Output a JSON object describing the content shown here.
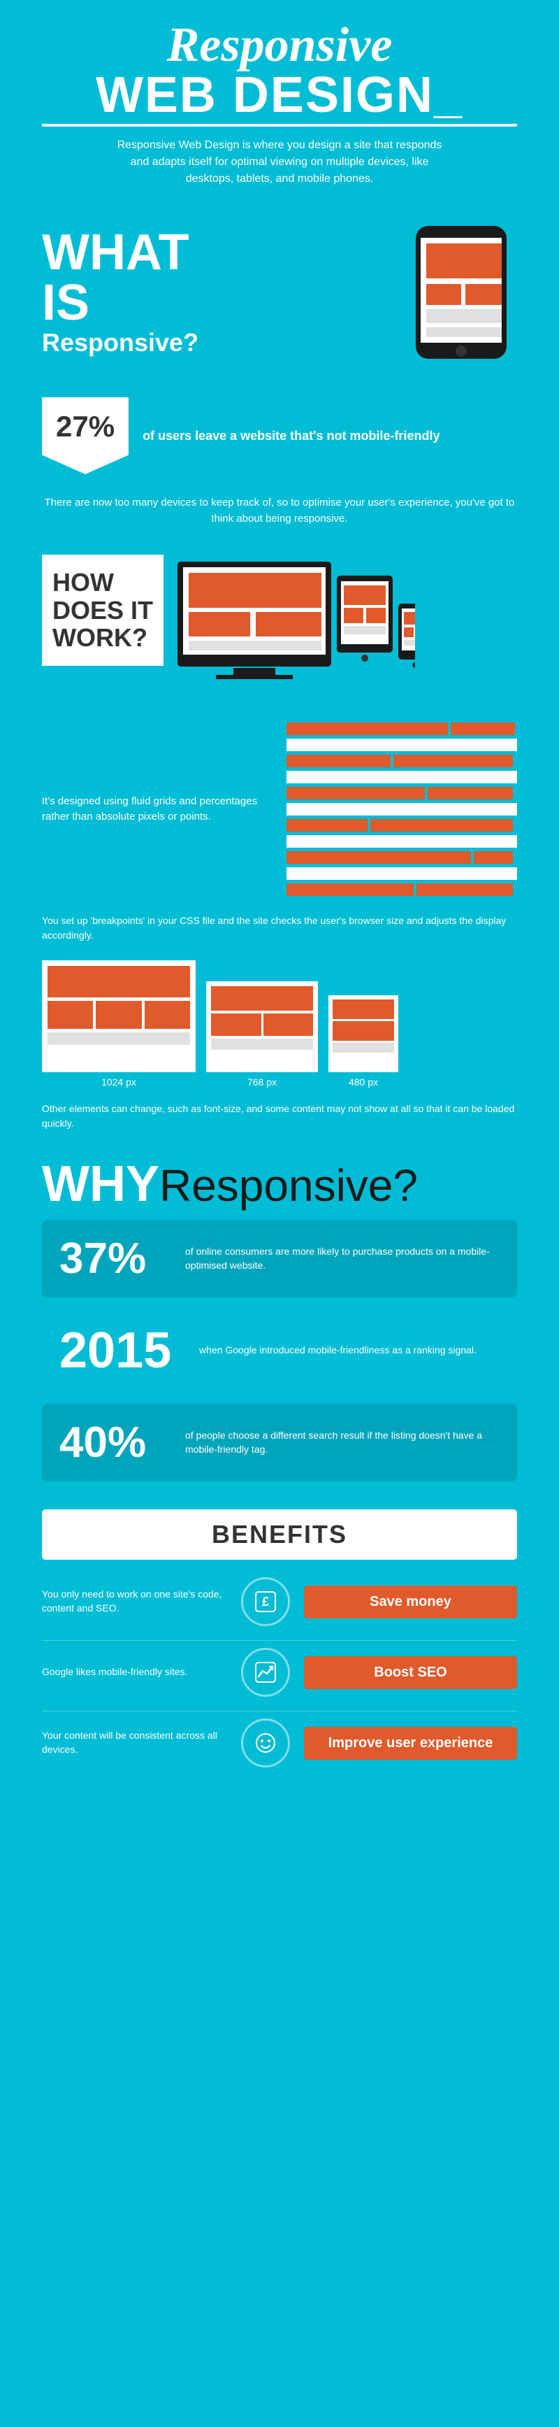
{
  "header": {
    "title_italic": "Responsive",
    "title_bold": "WEB DESIGN_",
    "description": "Responsive Web Design is where you design a site that responds and adapts itself for optimal viewing on multiple devices, like desktops, tablets, and mobile phones."
  },
  "what_is": {
    "what": "WHAT",
    "is": "IS",
    "responsive": "Responsive?",
    "stat_percent": "27%",
    "stat_desc": "of users leave a website that's not mobile-friendly",
    "optimise_text": "There are now too many devices to keep track of, so to optimise your user's experience, you've got to think about being responsive."
  },
  "how_it_works": {
    "title_line1": "HOW",
    "title_line2": "DOES IT",
    "title_line3": "WORK?",
    "fluid_desc": "It's designed using fluid grids and percentages rather than absolute pixels or points.",
    "breakpoints_text": "You set up 'breakpoints' in your CSS file and the site checks the user's browser size and adjusts the display accordingly.",
    "bp1_label": "1024 px",
    "bp2_label": "768 px",
    "bp3_label": "480 px",
    "other_elements": "Other elements can change, such as font-size, and some content may not show at all so that it can be loaded quickly."
  },
  "why_responsive": {
    "why": "WHY",
    "responsive": "Responsive?",
    "stat1_number": "37%",
    "stat1_desc": "of online consumers are more likely to purchase products on a mobile-optimised website.",
    "stat2_number": "2015",
    "stat2_desc": "when Google introduced mobile-friendliness as a ranking signal.",
    "stat3_number": "40%",
    "stat3_desc": "of people choose a different search result if the listing doesn't have a mobile-friendly tag."
  },
  "benefits": {
    "title": "BENEFITS",
    "row1_left": "You only need to work on one site's code, content and SEO.",
    "row1_badge": "Save money",
    "row2_left": "Google likes mobile-friendly sites.",
    "row2_badge": "Boost SEO",
    "row3_left": "Your content will be consistent across all devices.",
    "row3_badge": "Improve user experience"
  },
  "colors": {
    "bg_main": "#00bcd4",
    "orange": "#e05a2b",
    "dark": "#1a1a1a",
    "white": "#ffffff"
  }
}
